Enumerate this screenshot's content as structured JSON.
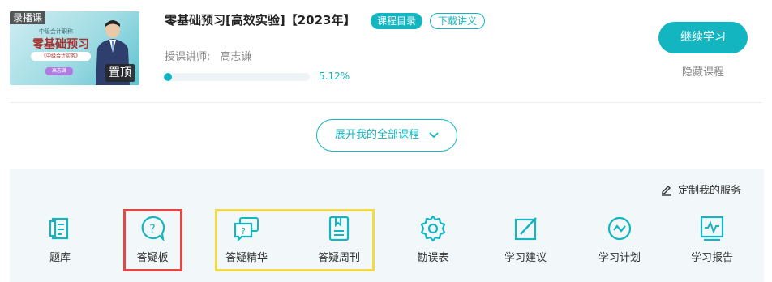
{
  "course": {
    "thumbnail": {
      "type_tag": "录播课",
      "mini_subtitle": "中级会计职称",
      "mini_title": "零基础预习",
      "mini_pill": "《中级会计实务》",
      "mini_badge": "高志谦",
      "pin_label": "置顶"
    },
    "title": "零基础预习[高效实验]【2023年】",
    "catalog_label": "课程目录",
    "download_label": "下载讲义",
    "teacher_label": "授课讲师:",
    "teacher_name": "高志谦",
    "progress_percent": 5.12,
    "progress_text": "5.12%",
    "continue_label": "继续学习",
    "hide_label": "隐藏课程"
  },
  "expand_label": "展开我的全部课程",
  "services": {
    "custom_label": "定制我的服务",
    "items": [
      {
        "label": "题库",
        "icon": "question-bank-icon"
      },
      {
        "label": "答疑板",
        "icon": "qa-board-icon"
      },
      {
        "label": "答疑精华",
        "icon": "qa-highlights-icon"
      },
      {
        "label": "答疑周刊",
        "icon": "qa-weekly-icon"
      },
      {
        "label": "勘误表",
        "icon": "errata-icon"
      },
      {
        "label": "学习建议",
        "icon": "study-advice-icon"
      },
      {
        "label": "学习计划",
        "icon": "study-plan-icon"
      },
      {
        "label": "学习报告",
        "icon": "study-report-icon"
      }
    ]
  },
  "colors": {
    "accent": "#13b5c1",
    "highlight_red": "#e04848",
    "highlight_yellow": "#f2d94a",
    "panel_bg": "#f2f8fa"
  }
}
